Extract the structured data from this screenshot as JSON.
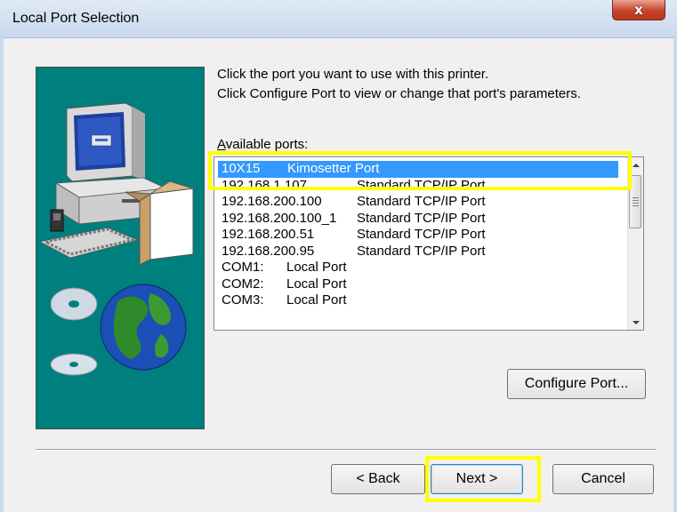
{
  "window": {
    "title": "Local Port Selection",
    "close_glyph": "x"
  },
  "instructions": {
    "line1": "Click the port you want to use with this printer.",
    "line2": "Click Configure Port to view or change that port's parameters."
  },
  "ports": {
    "label_prefix": "",
    "label_underlined": "A",
    "label_rest": "vailable ports:",
    "rows": [
      {
        "name": "10X15",
        "desc": "Kimosetter Port",
        "selected": true
      },
      {
        "name": "192.168.1.107",
        "desc": "Standard TCP/IP Port"
      },
      {
        "name": "192.168.200.100",
        "desc": "Standard TCP/IP Port"
      },
      {
        "name": "192.168.200.100_1",
        "desc": "Standard TCP/IP Port"
      },
      {
        "name": "192.168.200.51",
        "desc": "Standard TCP/IP Port"
      },
      {
        "name": "192.168.200.95",
        "desc": "Standard TCP/IP Port"
      },
      {
        "name": "COM1:",
        "desc": "Local Port"
      },
      {
        "name": "COM2:",
        "desc": "Local Port"
      },
      {
        "name": "COM3:",
        "desc": "Local Port"
      }
    ]
  },
  "buttons": {
    "configure": "Configure Port...",
    "back": "< Back",
    "next": "Next >",
    "cancel": "Cancel"
  },
  "colors": {
    "selection": "#3399ff",
    "highlight": "#ffff00",
    "art_background": "#007f7f"
  }
}
